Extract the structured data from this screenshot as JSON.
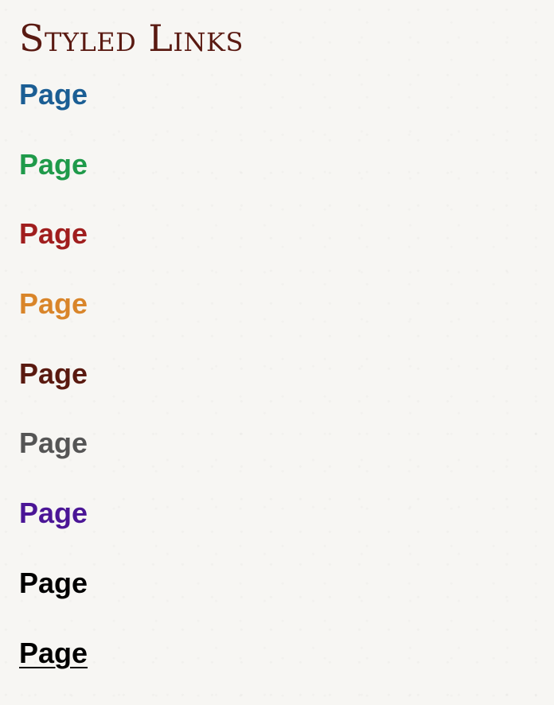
{
  "title": {
    "text": "Styled Links",
    "color": "#5a1a12"
  },
  "links": [
    {
      "label": "Page",
      "color": "#1b5e94",
      "underline": false
    },
    {
      "label": "Page",
      "color": "#1f9a4a",
      "underline": false
    },
    {
      "label": "Page",
      "color": "#a01e1e",
      "underline": false
    },
    {
      "label": "Page",
      "color": "#d9852a",
      "underline": false
    },
    {
      "label": "Page",
      "color": "#5a1a10",
      "underline": false
    },
    {
      "label": "Page",
      "color": "#555555",
      "underline": false
    },
    {
      "label": "Page",
      "color": "#4b1696",
      "underline": false
    },
    {
      "label": "Page",
      "color": "#000000",
      "underline": false
    },
    {
      "label": "Page",
      "color": "#000000",
      "underline": true
    }
  ]
}
